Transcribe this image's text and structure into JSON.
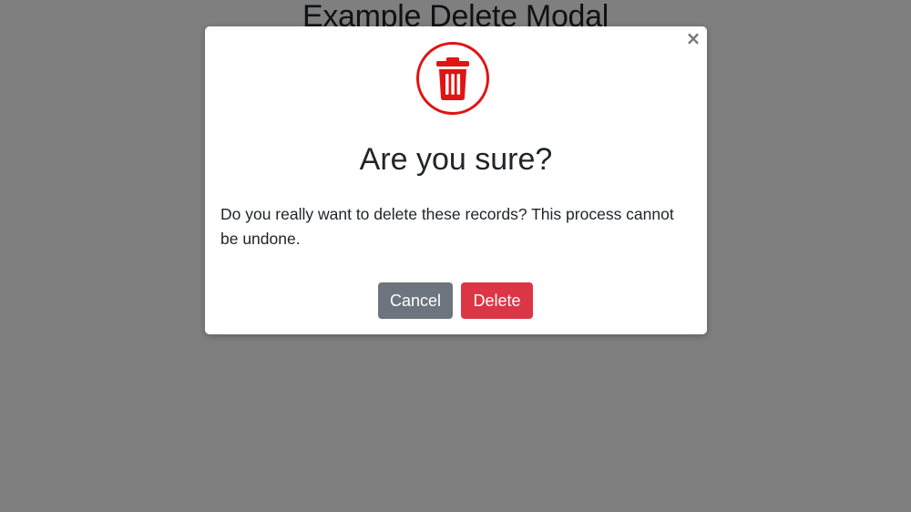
{
  "page": {
    "title": "Example Delete Modal"
  },
  "modal": {
    "close_label": "×",
    "icon": "trash-icon",
    "title": "Are you sure?",
    "message": "Do you really want to delete these records? This process cannot be undone.",
    "cancel_label": "Cancel",
    "delete_label": "Delete"
  },
  "colors": {
    "danger": "#dc3545",
    "icon_red": "#e01414",
    "secondary": "#6c757d",
    "backdrop": "#808080"
  }
}
